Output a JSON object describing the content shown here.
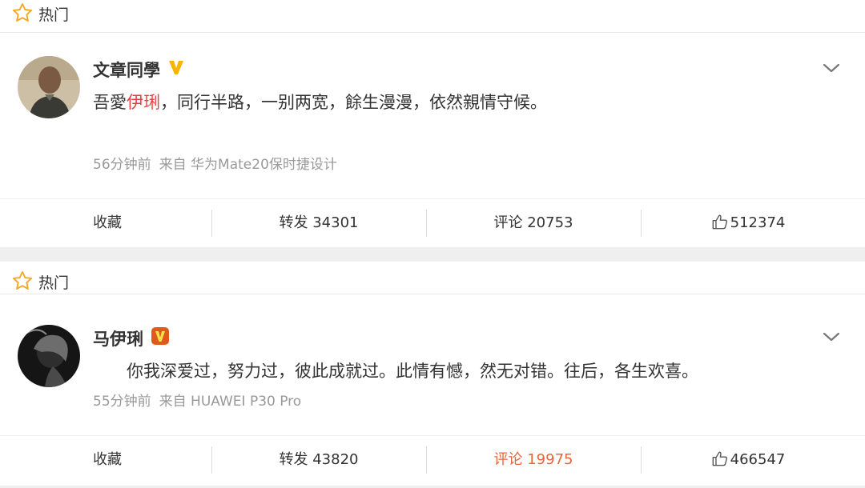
{
  "posts": [
    {
      "hot_label": "热门",
      "user": "文章同學",
      "text_before": "吾愛",
      "text_highlight": "伊琍",
      "text_after": "，同行半路，一别两宽，餘生漫漫，依然親情守候。",
      "time": "56分钟前",
      "source": "来自 华为Mate20保时捷设计",
      "actions": {
        "favorite": "收藏",
        "repost": "转发 34301",
        "comment": "评论 20753",
        "likes": "512374"
      },
      "badge_color": "#f7b500"
    },
    {
      "hot_label": "热门",
      "user": "马伊琍",
      "text": "你我深爱过，努力过，彼此成就过。此情有憾，然无对错。往后，各生欢喜。",
      "time": "55分钟前",
      "source": "来自 HUAWEI P30 Pro",
      "actions": {
        "favorite": "收藏",
        "repost": "转发 43820",
        "comment": "评论 19975",
        "likes": "466547"
      },
      "badge_color": "#e0581c"
    }
  ],
  "colors": {
    "highlight": "#eb3d3d",
    "comment_active": "#e8663a",
    "meta": "#999999"
  }
}
